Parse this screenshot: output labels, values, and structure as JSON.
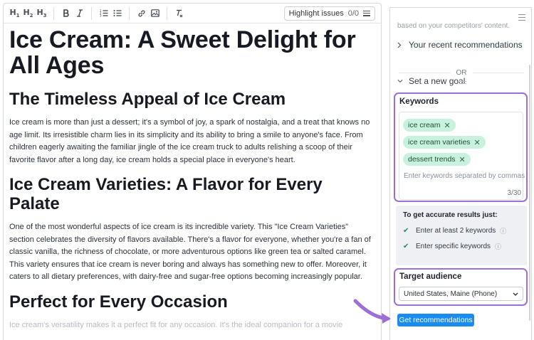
{
  "toolbar": {
    "h1": "H",
    "h1_sub": "1",
    "h2": "H",
    "h2_sub": "2",
    "h3": "H",
    "h3_sub": "3",
    "bold_icon": "bold-icon",
    "italic_icon": "italic-icon",
    "ordered_list_icon": "ordered-list-icon",
    "bullet_list_icon": "bullet-list-icon",
    "link_icon": "link-icon",
    "image_icon": "image-icon",
    "clear_format_icon": "clear-format-icon",
    "highlight_label": "Highlight issues",
    "highlight_count": "0/0"
  },
  "document": {
    "title": "Ice Cream: A Sweet Delight for All Ages",
    "sections": [
      {
        "heading": "The Timeless Appeal of Ice Cream",
        "body": "Ice cream is more than just a dessert; it's a symbol of joy, a spark of nostalgia, and a treat that knows no age limit. Its irresistible charm lies in its simplicity and its ability to bring a smile to anyone's face. From children eagerly awaiting the familiar jingle of the ice cream truck to adults relishing a scoop of their favorite flavor after a long day, ice cream holds a special place in everyone's heart."
      },
      {
        "heading": "Ice Cream Varieties: A Flavor for Every Palate",
        "body": "One of the most wonderful aspects of ice cream is its incredible variety. This \"Ice Cream Varieties\" section celebrates the diversity of flavors available. There's a flavor for everyone, whether you're a fan of classic vanilla, the richness of chocolate, or more adventurous options like green tea or salted caramel. This variety ensures that ice cream is never boring and always has something new to offer. Moreover, it caters to all dietary preferences, with dairy-free and sugar-free options becoming increasingly popular."
      },
      {
        "heading": "Perfect for Every Occasion",
        "body": "Ice cream's versatility makes it a perfect fit for any occasion. It's the ideal companion for a movie"
      }
    ]
  },
  "panel": {
    "cut_text": "based on your competitors' content.",
    "recent_label": "Your recent recommendations",
    "or_label": "OR",
    "new_goal_label": "Set a new goal",
    "keywords": {
      "title": "Keywords",
      "chips": [
        "ice cream",
        "ice cream varieties",
        "dessert trends"
      ],
      "placeholder": "Enter keywords separated by commas",
      "counter": "3/30"
    },
    "tips": {
      "head": "To get accurate results just:",
      "items": [
        "Enter at least 2 keywords",
        "Enter specific keywords"
      ]
    },
    "audience": {
      "title": "Target audience",
      "selected": "United States, Maine (Phone)"
    },
    "get_button": "Get recommendations"
  },
  "colors": {
    "accent_purple": "#9b6fd6",
    "chip_green": "#c9f2de",
    "button_blue": "#1a8cf0"
  }
}
